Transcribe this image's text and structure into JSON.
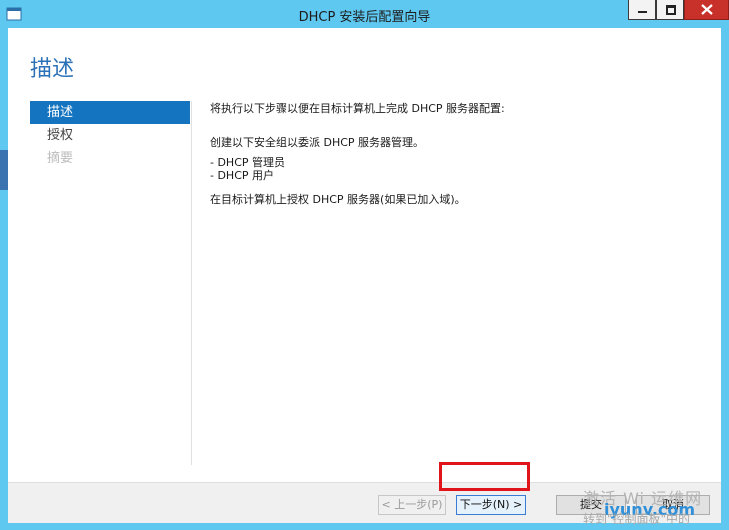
{
  "window": {
    "title": "DHCP 安装后配置向导"
  },
  "page": {
    "heading": "描述"
  },
  "nav": {
    "items": [
      {
        "label": "描述"
      },
      {
        "label": "授权"
      },
      {
        "label": "摘要"
      }
    ]
  },
  "content": {
    "line1": "将执行以下步骤以便在目标计算机上完成 DHCP 服务器配置:",
    "line2": "创建以下安全组以委派 DHCP 服务器管理。",
    "line3": "- DHCP 管理员",
    "line4": "- DHCP 用户",
    "line5": "在目标计算机上授权 DHCP 服务器(如果已加入域)。"
  },
  "buttons": {
    "prev": "< 上一步(P)",
    "next": "下一步(N) >",
    "submit": "提交",
    "cancel": "取消"
  },
  "watermark": {
    "line1": "激活 Wi  运维网",
    "line2": "iyunv.com",
    "line3": "转到\"控制面板\"中的"
  },
  "colors": {
    "accent": "#1474bf",
    "titlebar": "#5fc8f0",
    "highlight": "#e0141b"
  }
}
